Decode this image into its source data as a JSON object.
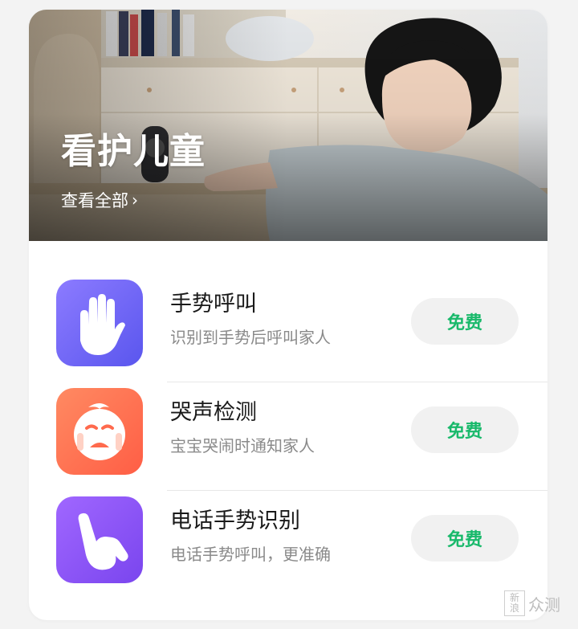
{
  "hero": {
    "title": "看护儿童",
    "link_label": "查看全部",
    "chevron": "›"
  },
  "features": [
    {
      "title": "手势呼叫",
      "subtitle": "识别到手势后呼叫家人",
      "button": "免费",
      "icon": "raised-hand-icon",
      "color": "#6f62f3"
    },
    {
      "title": "哭声检测",
      "subtitle": "宝宝哭闹时通知家人",
      "button": "免费",
      "icon": "crying-baby-icon",
      "color": "#ff6e4f"
    },
    {
      "title": "电话手势识别",
      "subtitle": "电话手势呼叫，更准确",
      "button": "免费",
      "icon": "phone-gesture-hand-icon",
      "color": "#8b54f2"
    }
  ],
  "watermark": {
    "seal_top": "新",
    "seal_bottom": "浪",
    "text": "众测"
  },
  "colors": {
    "accent_green": "#19b96b",
    "background": "#f3f3f3"
  }
}
